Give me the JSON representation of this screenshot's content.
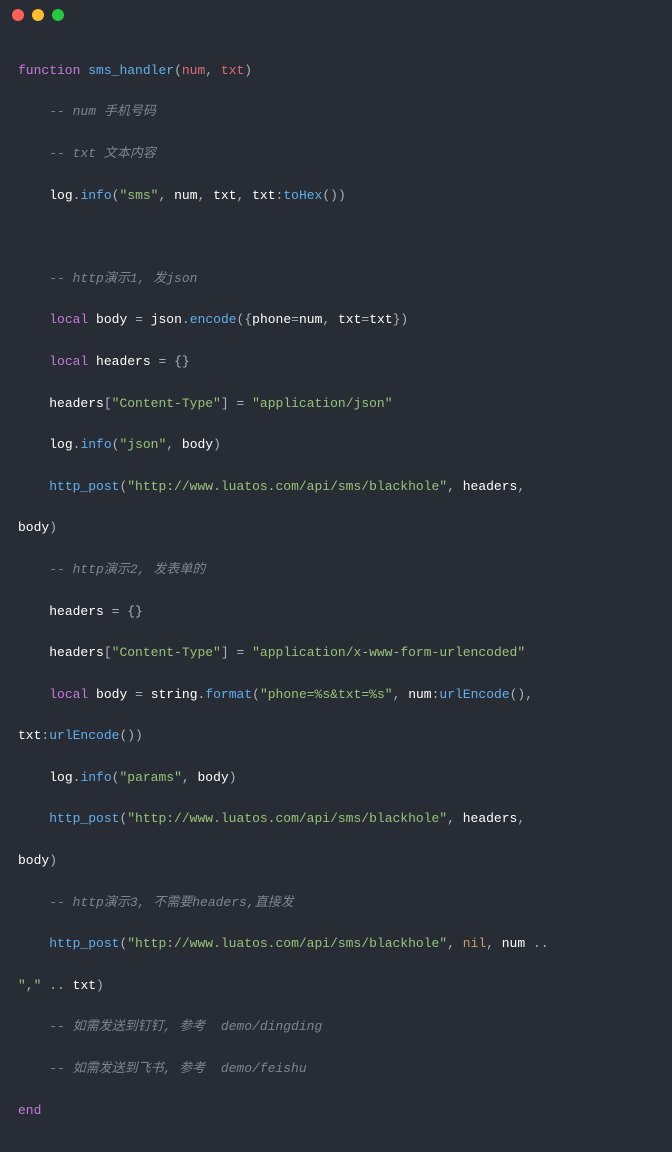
{
  "code": {
    "l1_kw1": "function",
    "l1_fn": "sms_handler",
    "l1_p1": "num",
    "l1_p2": "txt",
    "l2_comment": "-- num 手机号码",
    "l3_comment": "-- txt 文本内容",
    "l4_obj": "log",
    "l4_method": "info",
    "l4_s1": "\"sms\"",
    "l4_a1": "num",
    "l4_a2": "txt",
    "l4_a3": "txt",
    "l4_m3": "toHex",
    "l5_blank": "",
    "l6_comment": "-- http演示1, 发json",
    "l7_kw": "local",
    "l7_var": "body",
    "l7_obj": "json",
    "l7_method": "encode",
    "l7_k1": "phone",
    "l7_v1": "num",
    "l7_k2": "txt",
    "l7_v2": "txt",
    "l8_kw": "local",
    "l8_var": "headers",
    "l9_var": "headers",
    "l9_key": "\"Content-Type\"",
    "l9_val": "\"application/json\"",
    "l10_obj": "log",
    "l10_method": "info",
    "l10_s1": "\"json\"",
    "l10_a1": "body",
    "l11_fn": "http_post",
    "l11_url": "\"http://www.luatos.com/api/sms/blackhole\"",
    "l11_a2": "headers",
    "l11_a3_part": "body",
    "l12_comment": "-- http演示2, 发表单的",
    "l13_var": "headers",
    "l14_var": "headers",
    "l14_key": "\"Content-Type\"",
    "l14_val": "\"application/x-www-form-urlencoded\"",
    "l15_kw": "local",
    "l15_var": "body",
    "l15_obj": "string",
    "l15_method": "format",
    "l15_fmt": "\"phone=%s&txt=%s\"",
    "l15_a1": "num",
    "l15_m1": "urlEncode",
    "l16_a": "txt",
    "l16_m": "urlEncode",
    "l17_obj": "log",
    "l17_method": "info",
    "l17_s1": "\"params\"",
    "l17_a1": "body",
    "l18_fn": "http_post",
    "l18_url": "\"http://www.luatos.com/api/sms/blackhole\"",
    "l18_a2": "headers",
    "l18_a3_part": "body",
    "l19_comment": "-- http演示3, 不需要headers,直接发",
    "l20_fn": "http_post",
    "l20_url": "\"http://www.luatos.com/api/sms/blackhole\"",
    "l20_nil": "nil",
    "l20_a3": "num",
    "l21_s": "\",\"",
    "l21_a": "txt",
    "l22_comment": "-- 如需发送到钉钉, 参考  demo/dingding",
    "l23_comment": "-- 如需发送到飞书, 参考  demo/feishu",
    "l24_end": "end"
  }
}
